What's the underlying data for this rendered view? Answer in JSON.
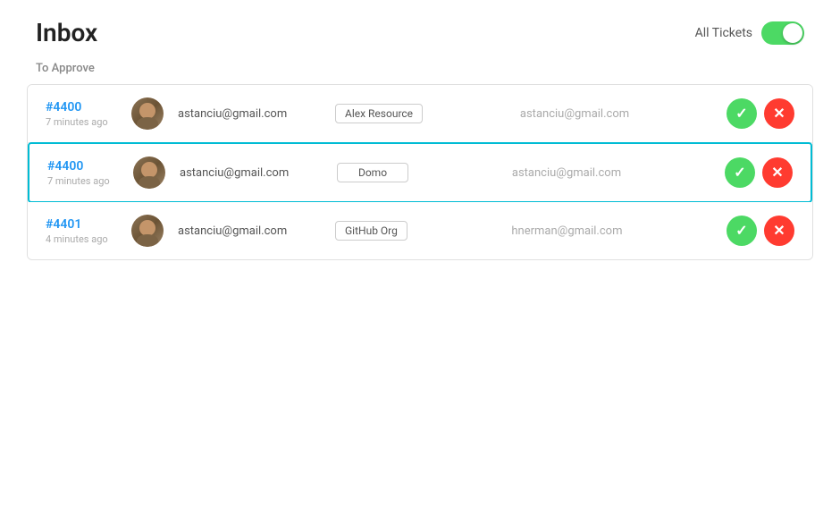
{
  "header": {
    "title": "Inbox",
    "toggle_label": "All Tickets",
    "toggle_state": true
  },
  "section": {
    "label": "To Approve"
  },
  "tickets": [
    {
      "id": "#4400",
      "time": "7 minutes ago",
      "requester": "astanciu@gmail.com",
      "resource": "Alex Resource",
      "assignee": "astanciu@gmail.com",
      "selected": false
    },
    {
      "id": "#4400",
      "time": "7 minutes ago",
      "requester": "astanciu@gmail.com",
      "resource": "Domo",
      "assignee": "astanciu@gmail.com",
      "selected": true
    },
    {
      "id": "#4401",
      "time": "4 minutes ago",
      "requester": "astanciu@gmail.com",
      "resource": "GitHub Org",
      "assignee": "hnerman@gmail.com",
      "selected": false
    }
  ],
  "buttons": {
    "approve_label": "✓",
    "reject_label": "✕"
  }
}
